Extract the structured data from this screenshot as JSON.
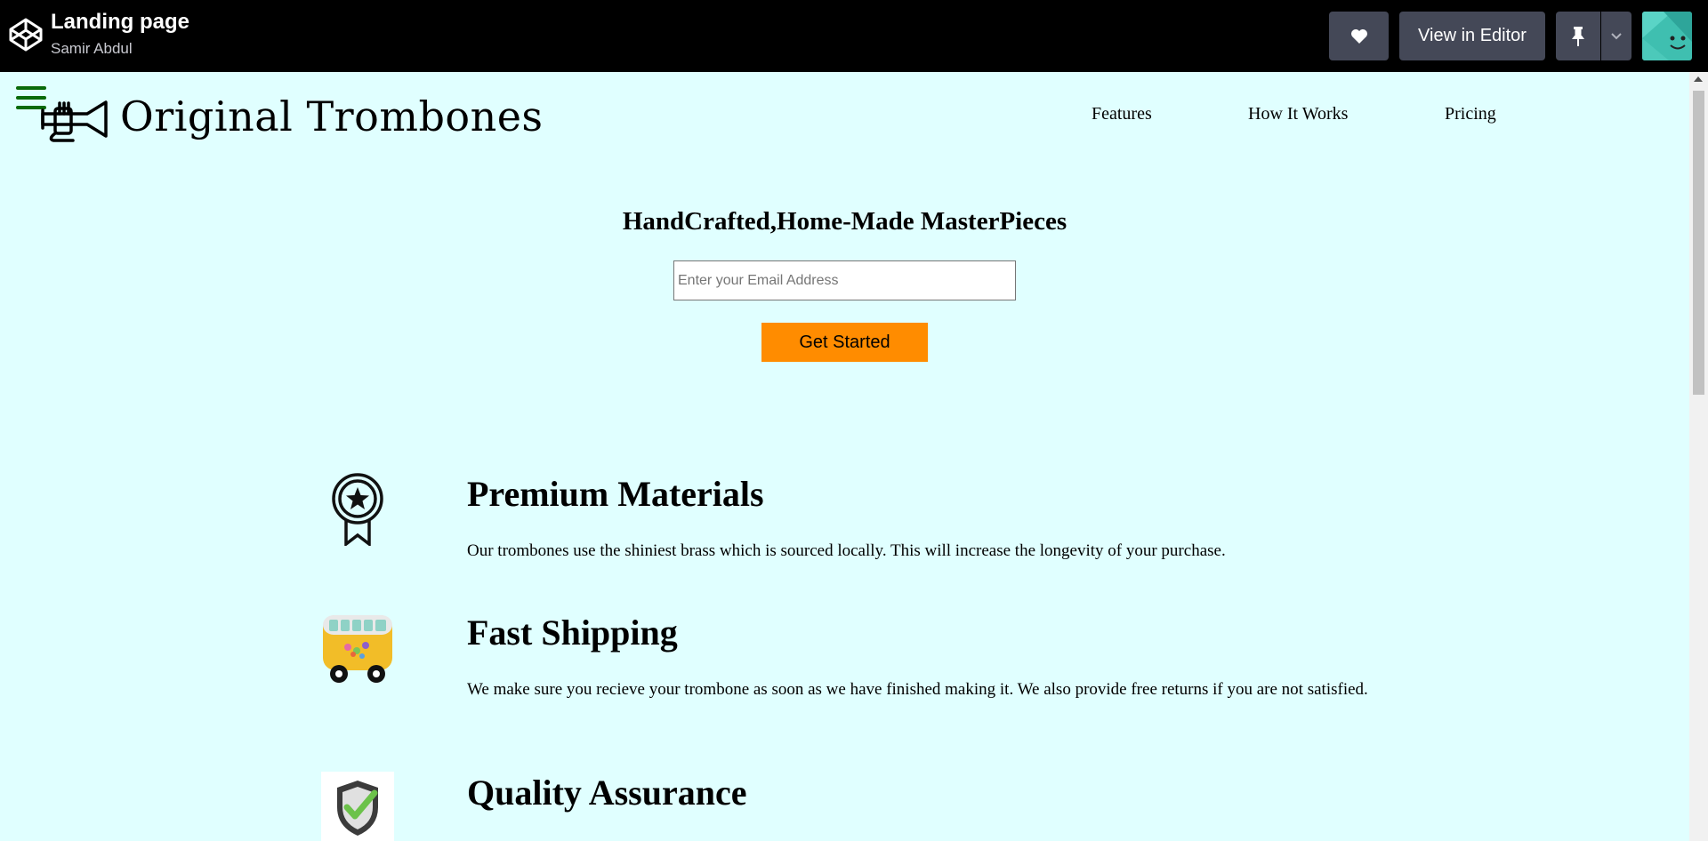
{
  "topbar": {
    "title": "Landing page",
    "author": "Samir Abdul",
    "view_in_editor": "View in Editor",
    "icons": [
      "codepen-logo-icon",
      "heart-icon",
      "pin-icon",
      "chevron-down-icon"
    ]
  },
  "nav": {
    "brand": "Original Trombones",
    "links": [
      "Features",
      "How It Works",
      "Pricing"
    ]
  },
  "hero": {
    "title": "HandCrafted,Home-Made MasterPieces",
    "email_placeholder": "Enter your Email Address",
    "button": "Get Started"
  },
  "features": [
    {
      "icon": "award-badge-icon",
      "title": "Premium Materials",
      "description": "Our trombones use the shiniest brass which is sourced locally. This will increase the longevity of your purchase."
    },
    {
      "icon": "van-icon",
      "title": "Fast Shipping",
      "description": "We make sure you recieve your trombone as soon as we have finished making it. We also provide free returns if you are not satisfied."
    },
    {
      "icon": "shield-check-icon",
      "title": "Quality Assurance",
      "description": ""
    }
  ],
  "colors": {
    "page_bg": "#e0ffff",
    "topbar_bg": "#000000",
    "button_orange": "#ff8c00",
    "hamburger_green": "#0a6a0a"
  }
}
